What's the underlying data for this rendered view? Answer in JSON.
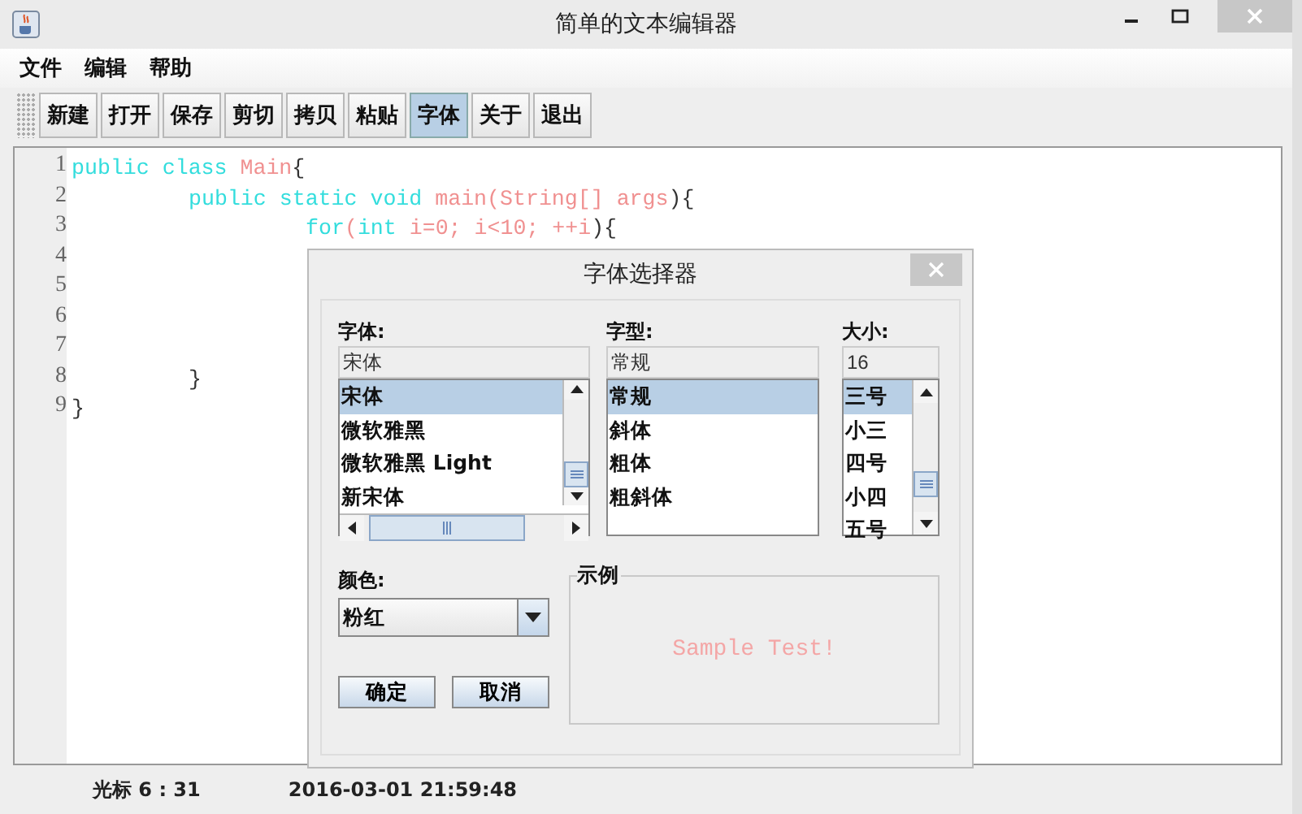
{
  "window": {
    "title": "简单的文本编辑器"
  },
  "menu": [
    "文件",
    "编辑",
    "帮助"
  ],
  "toolbar": [
    {
      "label": "新建",
      "selected": false
    },
    {
      "label": "打开",
      "selected": false
    },
    {
      "label": "保存",
      "selected": false
    },
    {
      "label": "剪切",
      "selected": false
    },
    {
      "label": "拷贝",
      "selected": false
    },
    {
      "label": "粘贴",
      "selected": false
    },
    {
      "label": "字体",
      "selected": true
    },
    {
      "label": "关于",
      "selected": false
    },
    {
      "label": "退出",
      "selected": false
    }
  ],
  "editor": {
    "lines": [
      {
        "number": "1",
        "tokens": [
          {
            "kind": "keyword",
            "text": "public class "
          },
          {
            "kind": "name",
            "text": "Main"
          },
          {
            "kind": "plain",
            "text": "{"
          }
        ]
      },
      {
        "number": "2",
        "tokens": [
          {
            "kind": "tab"
          },
          {
            "kind": "keyword",
            "text": "public static void "
          },
          {
            "kind": "name",
            "text": "main(String[] args"
          },
          {
            "kind": "plain",
            "text": "){"
          }
        ]
      },
      {
        "number": "3",
        "tokens": [
          {
            "kind": "tab"
          },
          {
            "kind": "tab"
          },
          {
            "kind": "keyword",
            "text": "for"
          },
          {
            "kind": "name",
            "text": "("
          },
          {
            "kind": "keyword",
            "text": "int "
          },
          {
            "kind": "name",
            "text": "i=0; i<10; ++i"
          },
          {
            "kind": "plain",
            "text": "){"
          }
        ]
      },
      {
        "number": "4"
      },
      {
        "number": "5"
      },
      {
        "number": "6"
      },
      {
        "number": "7"
      },
      {
        "number": "8",
        "tokens": [
          {
            "kind": "tab"
          },
          {
            "kind": "plain",
            "text": "}"
          }
        ]
      },
      {
        "number": "9",
        "tokens": [
          {
            "kind": "plain",
            "text": "}"
          }
        ]
      }
    ]
  },
  "status_bar": {
    "cursor": "光标 6 : 31",
    "datetime": "2016-03-01 21:59:48"
  },
  "dialog": {
    "title": "字体选择器",
    "font": {
      "label": "字体:",
      "value": "宋体",
      "items": [
        {
          "label": "宋体",
          "selected": true
        },
        {
          "label": "微软雅黑",
          "selected": false
        },
        {
          "label": "微软雅黑 Light",
          "selected": false
        },
        {
          "label": "新宋体",
          "selected": false
        }
      ]
    },
    "style": {
      "label": "字型:",
      "value": "常规",
      "items": [
        {
          "label": "常规",
          "selected": true
        },
        {
          "label": "斜体",
          "selected": false
        },
        {
          "label": "粗体",
          "selected": false
        },
        {
          "label": "粗斜体",
          "selected": false
        }
      ]
    },
    "size": {
      "label": "大小:",
      "value": "16",
      "items": [
        {
          "label": "三号",
          "selected": true
        },
        {
          "label": "小三",
          "selected": false
        },
        {
          "label": "四号",
          "selected": false
        },
        {
          "label": "小四",
          "selected": false
        },
        {
          "label": "五号",
          "selected": false
        }
      ]
    },
    "color": {
      "label": "颜色:",
      "value": "粉红"
    },
    "buttons": [
      "确定",
      "取消"
    ],
    "sample": {
      "label": "示例",
      "text": "Sample Test!"
    }
  }
}
